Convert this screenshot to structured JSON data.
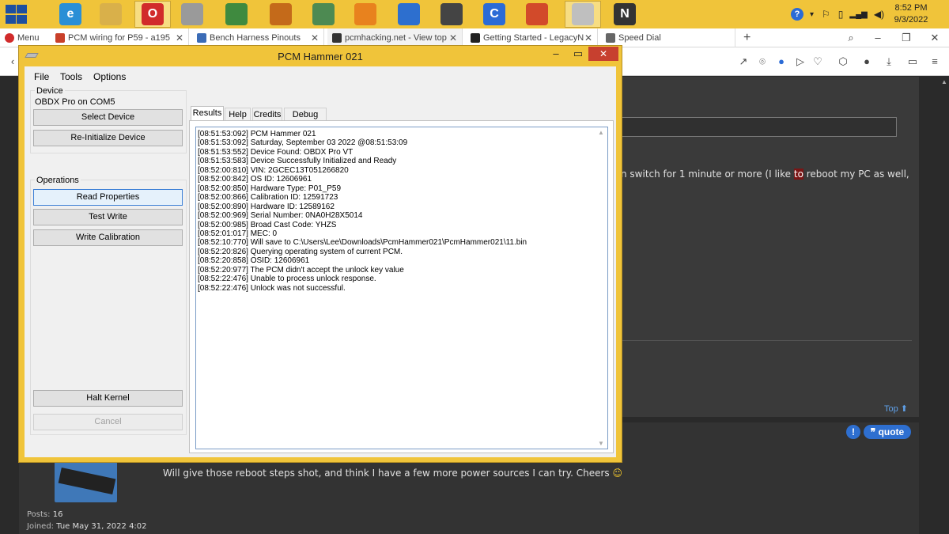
{
  "taskbar": {
    "apps": [
      {
        "name": "internet-explorer",
        "color": "#2a8fd6",
        "glyph": "e"
      },
      {
        "name": "file-explorer",
        "color": "#d9b04a",
        "glyph": ""
      },
      {
        "name": "opera",
        "color": "#d12b2b",
        "glyph": "O"
      },
      {
        "name": "snowman-app",
        "color": "#9a9a9a",
        "glyph": ""
      },
      {
        "name": "map-app",
        "color": "#3f8a3f",
        "glyph": ""
      },
      {
        "name": "target-app",
        "color": "#c46a1a",
        "glyph": ""
      },
      {
        "name": "chart-app",
        "color": "#4d8a52",
        "glyph": ""
      },
      {
        "name": "vlc",
        "color": "#e8821e",
        "glyph": ""
      },
      {
        "name": "thunderbird",
        "color": "#2d6fcf",
        "glyph": ""
      },
      {
        "name": "car-app",
        "color": "#444444",
        "glyph": ""
      },
      {
        "name": "ccleaner",
        "color": "#2b6bd6",
        "glyph": "C"
      },
      {
        "name": "settings-app",
        "color": "#d24a2a",
        "glyph": ""
      },
      {
        "name": "pcm-hammer",
        "color": "#bfbfbf",
        "glyph": ""
      },
      {
        "name": "n-app",
        "color": "#333333",
        "glyph": "N"
      }
    ],
    "clock_time": "8:52 PM",
    "clock_date": "9/3/2022"
  },
  "browser": {
    "menu_label": "Menu",
    "tabs": [
      {
        "title": "PCM wiring for P59 - a195",
        "color": "#c9402a"
      },
      {
        "title": "Bench Harness Pinouts",
        "color": "#3b6cb7"
      },
      {
        "title": "pcmhacking.net - View top",
        "color": "#333333"
      },
      {
        "title": "Getting Started - LegacyNs",
        "color": "#222222"
      },
      {
        "title": "Speed Dial",
        "color": "#666666"
      }
    ],
    "new_tab": "+"
  },
  "forum": {
    "line_prefix": "n switch for 1 minute or more (I like ",
    "line_highlight": "to",
    "line_suffix": " reboot my PC as well,",
    "top_link": "Top",
    "quote_label": "quote",
    "reply_text": "Will give those reboot steps shot, and think I have a few more power sources I can try. Cheers",
    "posts_label": "Posts:",
    "posts_value": "16",
    "joined_label": "Joined:",
    "joined_value": "Tue May 31, 2022 4:02"
  },
  "pcm": {
    "title": "PCM Hammer 021",
    "menu": [
      "File",
      "Tools",
      "Options"
    ],
    "device_group": "Device",
    "device_status": "OBDX Pro on COM5",
    "select_device": "Select Device",
    "reinit_device": "Re-Initialize Device",
    "operations_group": "Operations",
    "read_properties": "Read Properties",
    "test_write": "Test Write",
    "write_calibration": "Write Calibration",
    "halt_kernel": "Halt Kernel",
    "cancel": "Cancel",
    "tabs": [
      "Results",
      "Help",
      "Credits",
      "Debug Log"
    ],
    "log": [
      "[08:51:53:092]  PCM Hammer 021",
      "[08:51:53:092]  Saturday, September 03 2022 @08:51:53:09",
      "[08:51:53:552]  Device Found: OBDX Pro VT",
      "[08:51:53:583]  Device Successfully Initialized and Ready",
      "[08:52:00:810]  VIN: 2GCEC13T051266820",
      "[08:52:00:842]  OS ID: 12606961",
      "[08:52:00:850]  Hardware Type: P01_P59",
      "[08:52:00:866]  Calibration ID: 12591723",
      "[08:52:00:890]  Hardware ID: 12589162",
      "[08:52:00:969]  Serial Number: 0NA0H28X5014",
      "[08:52:00:985]  Broad Cast Code: YHZS",
      "[08:52:01:017]  MEC: 0",
      "[08:52:10:770]  Will save to C:\\Users\\Lee\\Downloads\\PcmHammer021\\PcmHammer021\\11.bin",
      "[08:52:20:826]  Querying operating system of current PCM.",
      "[08:52:20:858]  OSID: 12606961",
      "[08:52:20:977]  The PCM didn't accept the unlock key value",
      "[08:52:22:476]  Unable to process unlock response.",
      "[08:52:22:476]  Unlock was not successful."
    ]
  }
}
